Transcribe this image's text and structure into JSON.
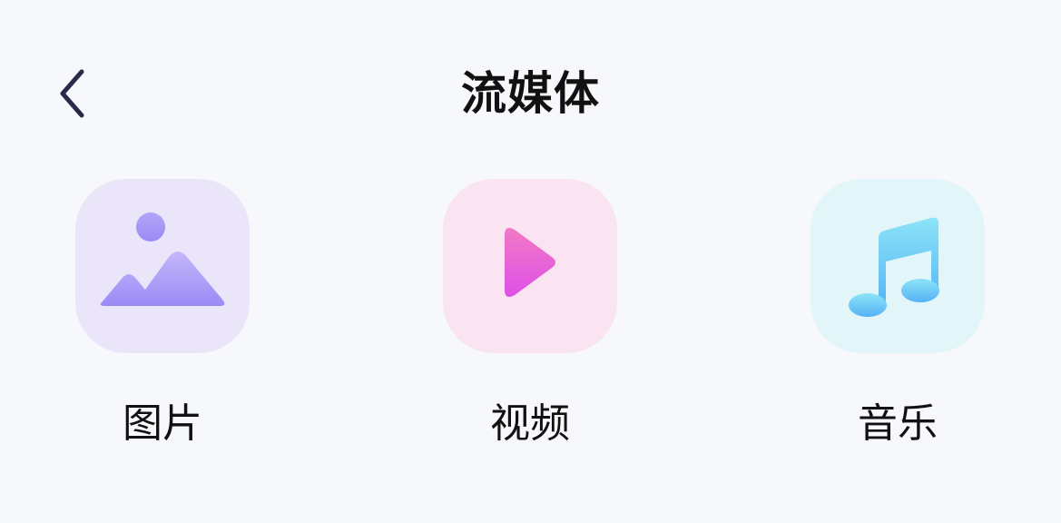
{
  "header": {
    "title": "流媒体",
    "back_icon": "chevron-left-icon"
  },
  "colors": {
    "background": "#f7f8fb",
    "title_text": "#111111",
    "back_icon": "#2a2a48"
  },
  "tiles": [
    {
      "label": "图片",
      "icon": "image-icon",
      "tile_bg": "#ebe5fa",
      "icon_colors": [
        "#9b8af5",
        "#c4b7fa"
      ]
    },
    {
      "label": "视频",
      "icon": "play-icon",
      "tile_bg": "#fbe4f2",
      "icon_colors": [
        "#de50e7",
        "#f07ac4"
      ]
    },
    {
      "label": "音乐",
      "icon": "music-note-icon",
      "tile_bg": "#e2f5f9",
      "icon_colors": [
        "#55b2f5",
        "#8ce4f7"
      ]
    }
  ]
}
